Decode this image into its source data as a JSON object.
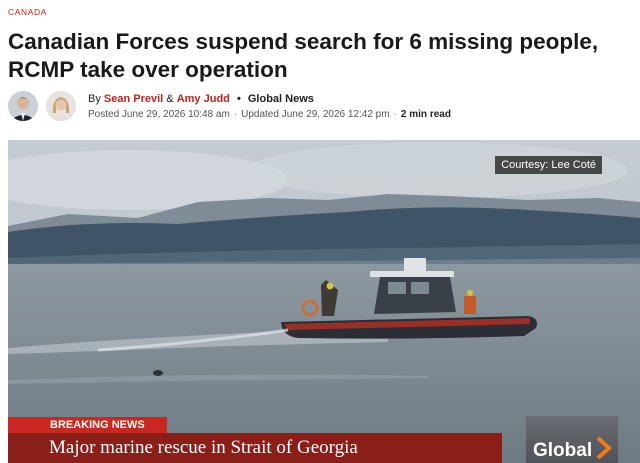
{
  "article": {
    "section": "CANADA",
    "headline": "Canadian Forces suspend search for 6 missing people, RCMP take over operation",
    "byline": {
      "prefix": "By",
      "author1": "Sean Previl",
      "joiner": "&",
      "author2": "Amy Judd",
      "bullet": "•",
      "outlet": "Global News"
    },
    "meta": {
      "posted": "Posted June 29, 2026 10:48 am",
      "updated": "Updated June 29, 2026 12:42 pm",
      "read_time": "2 min read"
    }
  },
  "hero": {
    "courtesy": "Courtesy: Lee Coté",
    "breaking_label": "BREAKING NEWS",
    "ticker_text": "Major marine rescue in Strait of Georgia",
    "brand": "Global"
  },
  "colors": {
    "accent_red": "#d1201b",
    "breaking_red": "#c8281f",
    "ticker_red": "#8a1f1a"
  }
}
